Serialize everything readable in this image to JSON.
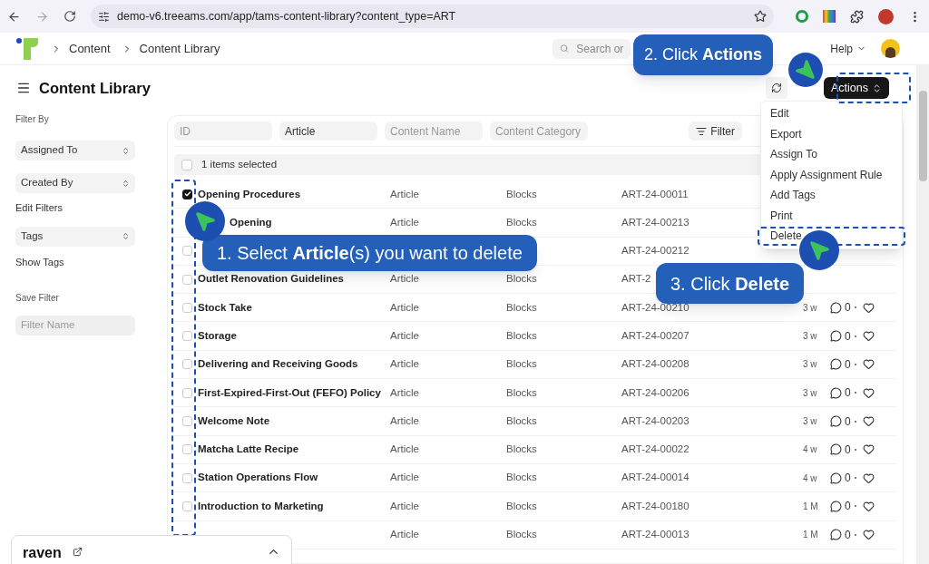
{
  "browser": {
    "url": "demo-v6.treeams.com/app/tams-content-library?content_type=ART"
  },
  "header": {
    "breadcrumbs": [
      "Content",
      "Content Library"
    ],
    "search_placeholder": "Search or",
    "help": "Help"
  },
  "page": {
    "title": "Content Library",
    "actions": {
      "label": "Actions",
      "highlighted": true
    }
  },
  "sidebar": {
    "heading": "Filter By",
    "selects": [
      "Assigned To",
      "Created By"
    ],
    "edit_filters": "Edit Filters",
    "tag_select": "Tags",
    "show_tags": "Show Tags",
    "save_heading": "Save Filter",
    "filter_name_placeholder": "Filter Name"
  },
  "filters": [
    {
      "placeholder": "ID"
    },
    {
      "value": "Article"
    },
    {
      "placeholder": "Content Name"
    },
    {
      "placeholder": "Content Category"
    }
  ],
  "filter_button": "Filter",
  "selection": {
    "label": "1 items selected",
    "checked": false
  },
  "rows": [
    {
      "checked": true,
      "name": "Opening Procedures",
      "type": "Article",
      "category": "Blocks",
      "id": "ART-24-00011"
    },
    {
      "kind": "partial",
      "name": "Opening",
      "type": "Article",
      "category": "Blocks",
      "id": "ART-24-00213"
    },
    {
      "checked": false,
      "id": "ART-24-00212"
    },
    {
      "checked": false,
      "name": "Outlet Renovation Guidelines",
      "type": "Article",
      "category": "Blocks",
      "id": "ART-2"
    },
    {
      "checked": false,
      "name": "Stock Take",
      "type": "Article",
      "category": "Blocks",
      "id": "ART-24-00210",
      "age": "3 w",
      "comments": "0"
    },
    {
      "checked": false,
      "name": "Storage",
      "type": "Article",
      "category": "Blocks",
      "id": "ART-24-00207",
      "age": "3 w",
      "comments": "0"
    },
    {
      "checked": false,
      "name": "Delivering and Receiving Goods",
      "type": "Article",
      "category": "Blocks",
      "id": "ART-24-00208",
      "age": "3 w",
      "comments": "0"
    },
    {
      "checked": false,
      "name": "First-Expired-First-Out (FEFO) Policy",
      "type": "Article",
      "category": "Blocks",
      "id": "ART-24-00206",
      "age": "3 w",
      "comments": "0"
    },
    {
      "checked": false,
      "name": "Welcome Note",
      "type": "Article",
      "category": "Blocks",
      "id": "ART-24-00203",
      "age": "3 w",
      "comments": "0"
    },
    {
      "checked": false,
      "name": "Matcha Latte Recipe",
      "type": "Article",
      "category": "Blocks",
      "id": "ART-24-00022",
      "age": "4 w",
      "comments": "0"
    },
    {
      "checked": false,
      "name": "Station Operations Flow",
      "type": "Article",
      "category": "Blocks",
      "id": "ART-24-00014",
      "age": "4 w",
      "comments": "0"
    },
    {
      "checked": false,
      "name": "Introduction to Marketing",
      "type": "Article",
      "category": "Blocks",
      "id": "ART-24-00180",
      "age": "1 M",
      "comments": "0"
    },
    {
      "type": "Article",
      "category": "Blocks",
      "id": "ART-24-00013",
      "age": "1 M",
      "comments": "0"
    }
  ],
  "menu": [
    {
      "label": "Edit",
      "highlighted": false
    },
    {
      "label": "Export",
      "highlighted": false
    },
    {
      "label": "Assign To",
      "highlighted": false
    },
    {
      "label": "Apply Assignment Rule",
      "highlighted": false
    },
    {
      "label": "Add Tags",
      "highlighted": false
    },
    {
      "label": "Print",
      "highlighted": false
    },
    {
      "label": "Delete",
      "highlighted": true
    }
  ],
  "callouts": [
    "1. Select **Article**(s) you want to delete",
    "2. Click **Actions**",
    "3. Click **Delete**"
  ],
  "widget": {
    "title": "raven"
  }
}
